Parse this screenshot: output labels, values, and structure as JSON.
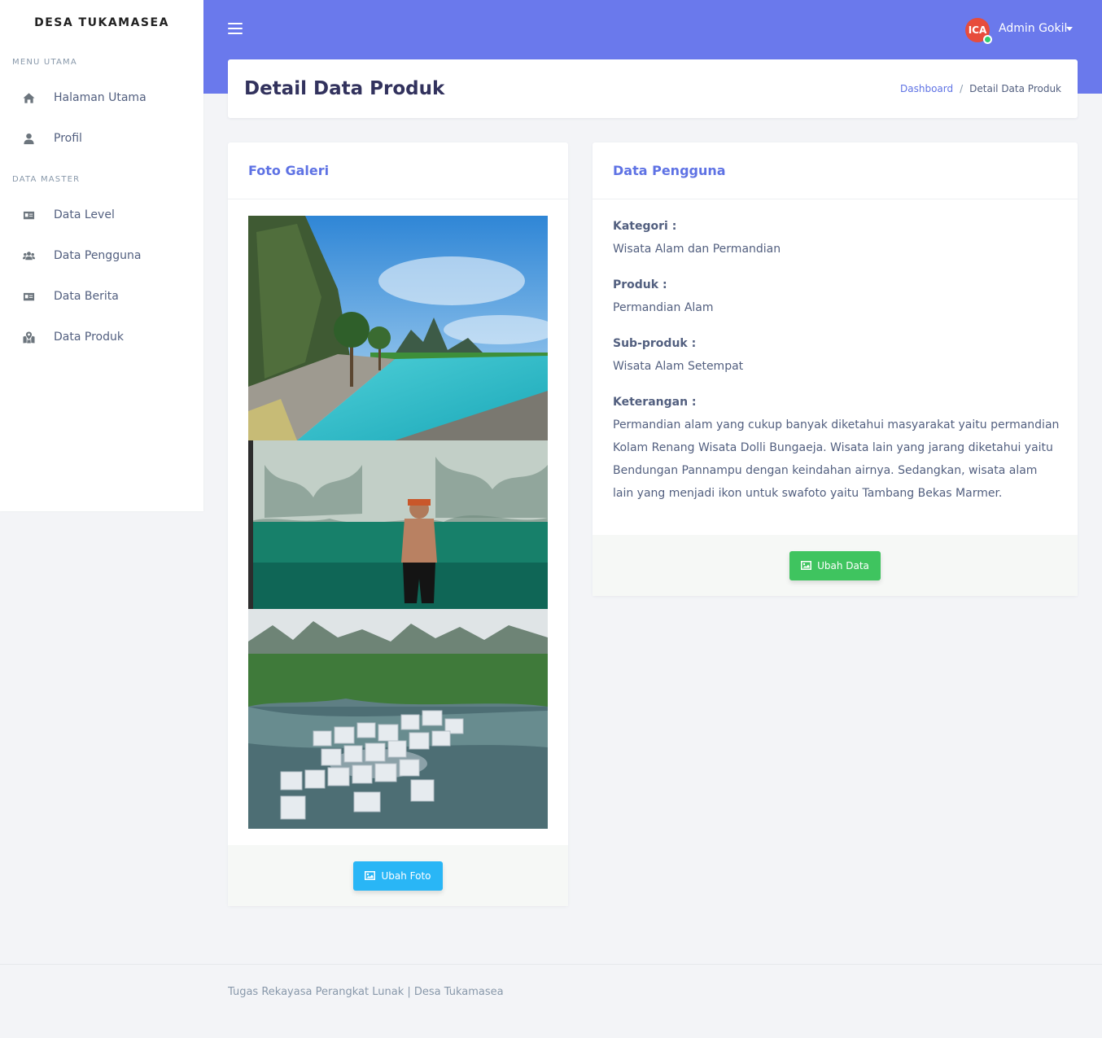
{
  "sidebar": {
    "brand": "DESA TUKAMASEA",
    "sections": [
      {
        "label": "MENU UTAMA"
      },
      {
        "label": "DATA MASTER"
      }
    ],
    "items": [
      {
        "label": "Halaman Utama",
        "icon": "home-icon"
      },
      {
        "label": "Profil",
        "icon": "user-icon"
      },
      {
        "label": "Data Level",
        "icon": "id-card-icon"
      },
      {
        "label": "Data Pengguna",
        "icon": "users-icon"
      },
      {
        "label": "Data Berita",
        "icon": "id-card-icon"
      },
      {
        "label": "Data Produk",
        "icon": "map-marked-icon"
      }
    ]
  },
  "topbar": {
    "menu_icon": "hamburger-icon",
    "avatar_initials": "ICA",
    "user_name": "Admin Gokil",
    "accent": "#6a79ec"
  },
  "header": {
    "title": "Detail Data Produk",
    "breadcrumb": [
      "Dashboard",
      "Detail Data Produk"
    ],
    "breadcrumb_separator": "/"
  },
  "gallery": {
    "title": "Foto Galeri",
    "photos": [
      {
        "alt": "photo-pool"
      },
      {
        "alt": "photo-lake-person"
      },
      {
        "alt": "photo-marble-lake"
      }
    ],
    "button_label": "Ubah Foto",
    "button_color": "#29b6f6"
  },
  "details": {
    "title": "Data Pengguna",
    "fields": [
      {
        "label": "Kategori :",
        "value": "Wisata Alam dan Permandian"
      },
      {
        "label": "Produk :",
        "value": "Permandian Alam"
      },
      {
        "label": "Sub-produk :",
        "value": "Wisata Alam Setempat"
      },
      {
        "label": "Keterangan :",
        "value": "Permandian alam yang cukup banyak diketahui masyarakat yaitu permandian Kolam Renang Wisata Dolli Bungaeja. Wisata lain yang jarang diketahui yaitu Bendungan Pannampu dengan keindahan airnya. Sedangkan, wisata alam lain yang menjadi ikon untuk swafoto yaitu Tambang Bekas Marmer."
      }
    ],
    "button_label": "Ubah Data",
    "button_color": "#3fc45f"
  },
  "footer": {
    "text": "Tugas Rekayasa Perangkat Lunak | Desa Tukamasea"
  }
}
